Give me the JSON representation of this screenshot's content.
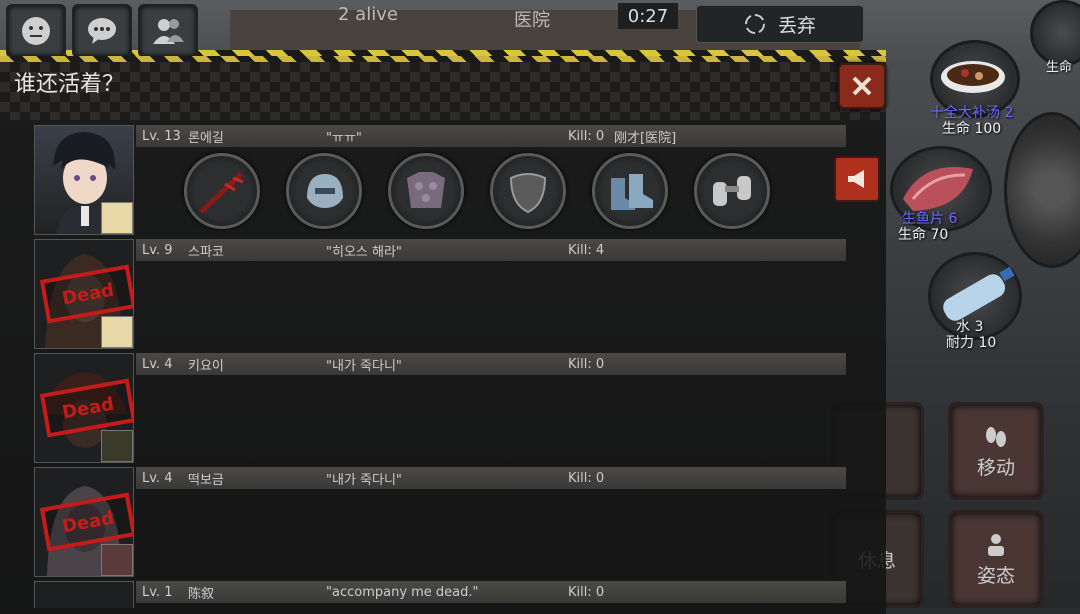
{
  "hud": {
    "alive_count": "2 alive",
    "location": "医院",
    "timer": "0:27",
    "discard_label": "丢弃"
  },
  "top_buttons": [
    {
      "icon": "face-icon"
    },
    {
      "icon": "chat-icon"
    },
    {
      "icon": "players-icon"
    }
  ],
  "panel": {
    "title": "谁还活着？"
  },
  "players": [
    {
      "level": "Lv. 13",
      "name": "론에길",
      "quote": "\"ㅠㅠ\"",
      "kills": "Kill: 0",
      "status": "刚才[医院]",
      "dead": false
    },
    {
      "level": "Lv. 9",
      "name": "스파코",
      "quote": "\"히오스 해라\"",
      "kills": "Kill: 4",
      "status": "",
      "dead": true
    },
    {
      "level": "Lv. 4",
      "name": "키요이",
      "quote": "\"내가 죽다니\"",
      "kills": "Kill: 0",
      "status": "",
      "dead": true
    },
    {
      "level": "Lv. 4",
      "name": "떡보금",
      "quote": "\"내가 죽다니\"",
      "kills": "Kill: 0",
      "status": "",
      "dead": true
    },
    {
      "level": "Lv. 1",
      "name": "陈叙",
      "quote": "\"accompany me dead.\"",
      "kills": "Kill: 0",
      "status": "",
      "dead": true
    }
  ],
  "dead_label": "Dead",
  "equipment": [
    {
      "icon": "sword-icon"
    },
    {
      "icon": "helmet-icon"
    },
    {
      "icon": "armor-icon"
    },
    {
      "icon": "shield-icon"
    },
    {
      "icon": "boots-icon"
    },
    {
      "icon": "binoculars-icon"
    }
  ],
  "inventory": [
    {
      "name": "十全大补汤 2",
      "stat": "生命 100",
      "icon": "soup-icon"
    },
    {
      "name": "生鱼片 6",
      "stat": "生命 70",
      "icon": "sashimi-icon"
    },
    {
      "name": "水 3",
      "stat": "耐力 10",
      "icon": "water-bottle-icon"
    }
  ],
  "actions": {
    "move_label": "移动",
    "stance_label": "姿态",
    "rest_label": "休息"
  },
  "colors": {
    "dead_red": "#c51b1b",
    "item_name_blue": "#6a6cff",
    "close_button": "#8a2a1a"
  }
}
